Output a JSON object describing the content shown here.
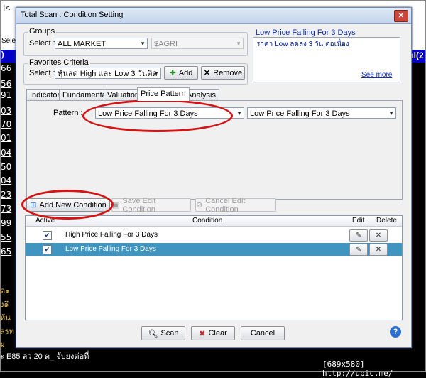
{
  "background": {
    "top_left": "I<",
    "top_sele": "Sele",
    "header_left": ")",
    "header_right": "al(2",
    "row_numbers": [
      "66",
      "56",
      "91",
      "03",
      "70",
      "01",
      "04",
      "50",
      "04",
      "23",
      "73",
      "99",
      "55",
      "65"
    ],
    "thai_lines": [
      "ุด๑",
      "ง๑ี",
      "ห้น",
      "ลรท",
      "ผ ",
      "ะ E85 ลว 20 ต_ จับยงต่อที่"
    ],
    "watermark": "[689x580] http://upic.me/"
  },
  "dialog": {
    "title": "Total Scan : Condition Setting",
    "close_label": "✕",
    "groups": {
      "label": "Groups",
      "select_label": "Select :",
      "market_value": "ALL MARKET",
      "sector_value": "$AGRI"
    },
    "favorites": {
      "label": "Favorites Criteria",
      "select_label": "Select :",
      "value": "หุ้นลด High และ Low 3 วันติด",
      "add_label": "Add",
      "remove_label": "Remove"
    },
    "description": {
      "title": "Low Price Falling For 3 Days",
      "text": "ราคา Low ลดลง 3 วัน ต่อเนื่อง",
      "see_more": "See more"
    },
    "tabs": [
      "Indicator",
      "Fundamental",
      "Valuation",
      "Price Pattern",
      "Analysis"
    ],
    "active_tab": "Price Pattern",
    "pattern": {
      "label": "Pattern :",
      "value1": "Low Price Falling For 3 Days",
      "value2": "Low Price Falling For 3 Days"
    },
    "actions": {
      "add_new": "Add New Condition",
      "save_edit": "Save Edit Condition",
      "cancel_edit": "Cancel Edit Condition"
    },
    "grid": {
      "headers": {
        "active": "Active",
        "condition": "Condition",
        "edit": "Edit",
        "delete": "Delete"
      },
      "rows": [
        {
          "active": true,
          "condition": "High Price Falling For 3 Days",
          "selected": false
        },
        {
          "active": true,
          "condition": "Low Price Falling For 3 Days",
          "selected": true
        }
      ]
    },
    "buttons": {
      "scan": "Scan",
      "clear": "Clear",
      "cancel": "Cancel",
      "help": "?"
    }
  },
  "colors": {
    "annotation_red": "#d41414",
    "selected_row": "#3f95c0",
    "header_blue": "#0000c8"
  }
}
